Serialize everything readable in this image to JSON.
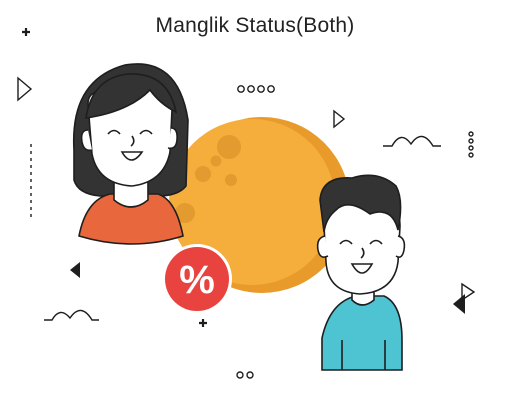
{
  "title": "Manglik Status(Both)",
  "badge_symbol": "%",
  "colors": {
    "moon": "#F5AE3C",
    "moon_shadow": "#E89B2A",
    "moon_crater": "#E39A2E",
    "woman_top": "#E8673C",
    "man_top": "#4EC3D2",
    "hair": "#333333",
    "badge": "#E8433F",
    "outline": "#1e1e1e"
  },
  "icons": {
    "woman": "woman-avatar-icon",
    "man": "man-avatar-icon",
    "moon": "moon-icon",
    "badge": "percent-badge-icon"
  }
}
